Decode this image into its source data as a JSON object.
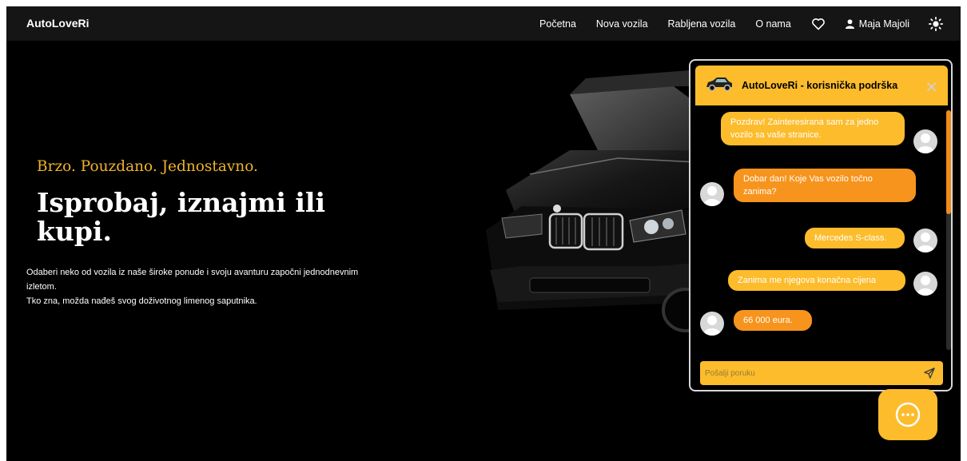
{
  "navbar": {
    "brand": "AutoLoveRi",
    "links": [
      "Početna",
      "Nova vozila",
      "Rabljena vozila",
      "O nama"
    ],
    "user_name": "Maja Majoli"
  },
  "hero": {
    "tagline": "Brzo. Pouzdano. Jednostavno.",
    "headline": "Isprobaj, iznajmi ili kupi.",
    "description_line1": "Odaberi neko od vozila iz naše široke ponude i svoju avanturu započni jednodnevnim izletom.",
    "description_line2": "Tko zna, možda nađeš svog doživotnog limenog saputnika."
  },
  "chat": {
    "title": "AutoLoveRi - korisnička podrška",
    "close_label": "✕",
    "messages": [
      {
        "from": "user",
        "text": "Pozdrav! Zainteresirana sam za jedno vozilo sa vaše stranice."
      },
      {
        "from": "agent",
        "text": "Dobar dan! Koje Vas vozilo točno zanima?"
      },
      {
        "from": "user",
        "text": "Mercedes S-class."
      },
      {
        "from": "user",
        "text": "Zanima me njegova konačna cijena"
      },
      {
        "from": "agent",
        "text": "66 000 eura."
      }
    ],
    "input_placeholder": "Pošalji poruku"
  },
  "colors": {
    "accent": "#fcbc2c",
    "agent_bubble": "#f7941d",
    "background": "#000000",
    "navbar": "#151515"
  },
  "icons": [
    "heart-icon",
    "user-icon",
    "sun-icon",
    "car-icon",
    "close-icon",
    "send-icon",
    "chat-bubble-icon"
  ]
}
